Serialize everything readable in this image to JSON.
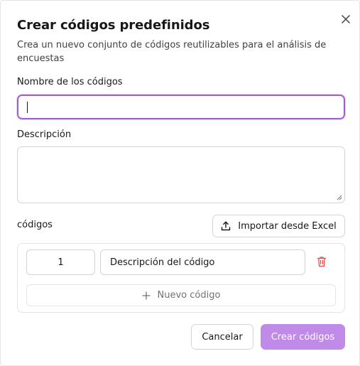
{
  "dialog": {
    "title": "Crear códigos predefinidos",
    "subtitle": "Crea un nuevo conjunto de códigos reutilizables para el análisis de encuestas"
  },
  "form": {
    "name_label": "Nombre de los códigos",
    "name_value": "",
    "description_label": "Descripción",
    "description_value": "",
    "codes_label": "códigos",
    "import_button": "Importar desde Excel",
    "codes": [
      {
        "number": "1",
        "description_placeholder": "Descripción del código"
      }
    ],
    "add_code_button": "Nuevo código"
  },
  "footer": {
    "cancel_button": "Cancelar",
    "create_button": "Crear códigos"
  },
  "colors": {
    "accent": "#9f5fd0",
    "create_button_bg": "#c08ae8",
    "delete_icon": "#ef4444"
  },
  "icons": [
    "close-icon",
    "upload-icon",
    "trash-icon",
    "plus-icon"
  ]
}
